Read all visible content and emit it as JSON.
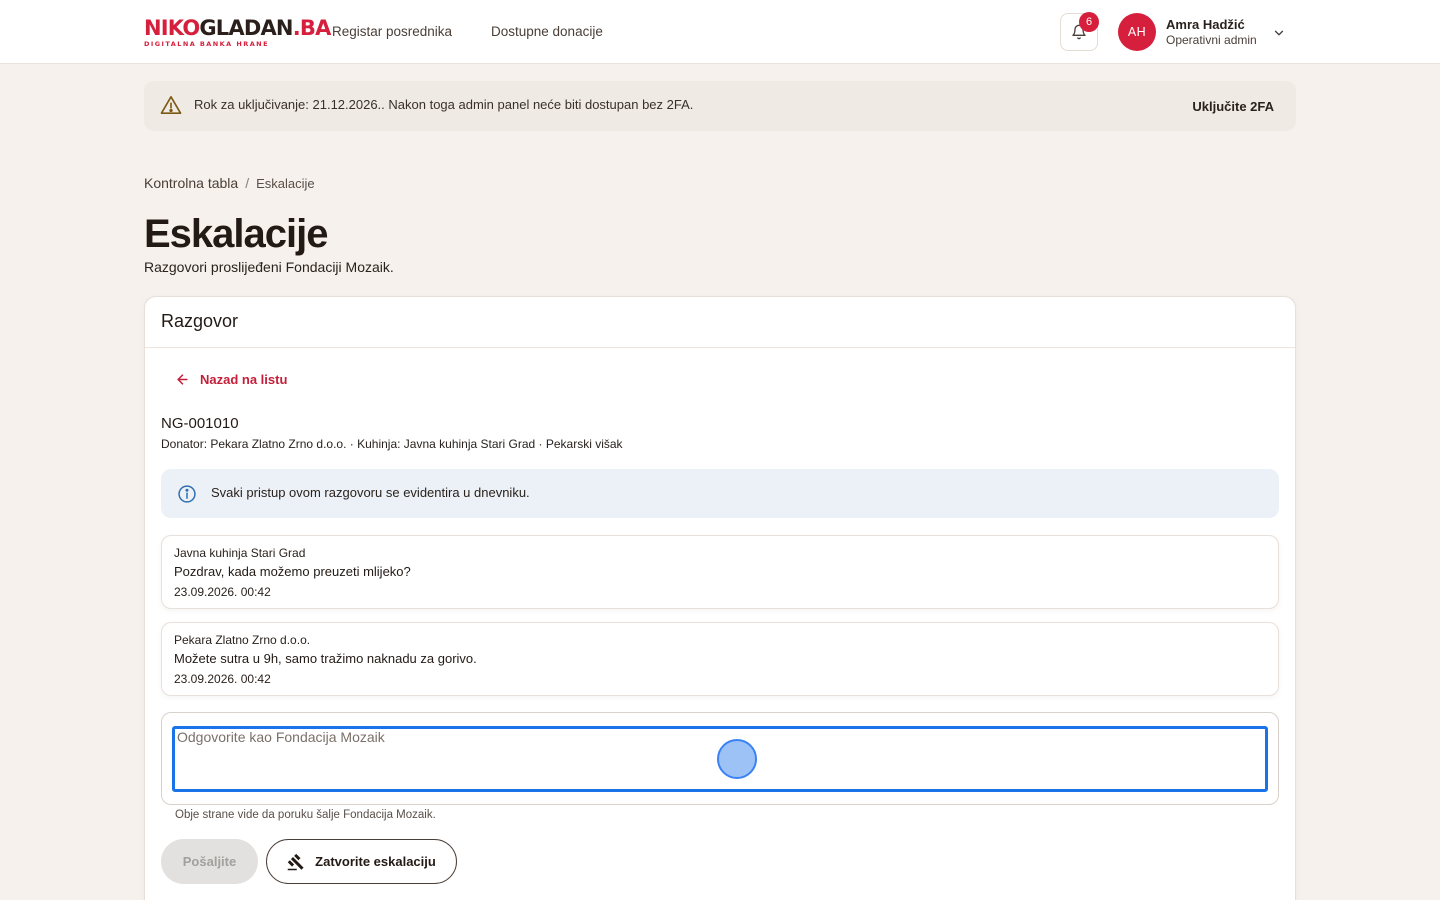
{
  "header": {
    "logo_part1": "NIKO",
    "logo_part2": "GLADAN",
    "logo_part3": ".BA",
    "logo_tagline": "DIGITALNA BANKA HRANE",
    "nav": [
      {
        "label": "Registar posrednika"
      },
      {
        "label": "Dostupne donacije"
      }
    ],
    "notification_count": "6",
    "user": {
      "initials": "AH",
      "name": "Amra Hadžić",
      "role": "Operativni admin"
    }
  },
  "alert": {
    "text": "Rok za uključivanje: 21.12.2026.. Nakon toga admin panel neće biti dostupan bez 2FA.",
    "action_label": "Uključite 2FA"
  },
  "breadcrumb": {
    "parent": "Kontrolna tabla",
    "separator": "/",
    "current": "Eskalacije"
  },
  "page": {
    "title": "Eskalacije",
    "subtitle": "Razgovori proslijeđeni Fondaciji Mozaik."
  },
  "card": {
    "title": "Razgovor",
    "back_label": "Nazad na listu",
    "conversation_id": "NG-001010",
    "meta": "Donator: Pekara Zlatno Zrno d.o.o. · Kuhinja: Javna kuhinja Stari Grad · Pekarski višak",
    "info_text": "Svaki pristup ovom razgovoru se evidentira u dnevniku.",
    "messages": [
      {
        "author": "Javna kuhinja Stari Grad",
        "text": "Pozdrav, kada možemo preuzeti mlijeko?",
        "time": "23.09.2026. 00:42"
      },
      {
        "author": "Pekara Zlatno Zrno d.o.o.",
        "text": "Možete sutra u 9h, samo tražimo naknadu za gorivo.",
        "time": "23.09.2026. 00:42"
      }
    ],
    "reply": {
      "placeholder": "Odgovorite kao Fondacija Mozaik",
      "value": ""
    },
    "hint": "Obje strane vide da poruku šalje Fondacija Mozaik.",
    "send_label": "Pošaljite",
    "close_label": "Zatvorite eskalaciju"
  },
  "colors": {
    "brand": "#d61f3c",
    "focus": "#1a73e8",
    "info_bg": "#ebf1f7",
    "alert_bg": "#f0eae4"
  },
  "icons": [
    "bell-icon",
    "chevron-down-icon",
    "warning-icon",
    "arrow-left-icon",
    "info-icon",
    "gavel-icon"
  ]
}
